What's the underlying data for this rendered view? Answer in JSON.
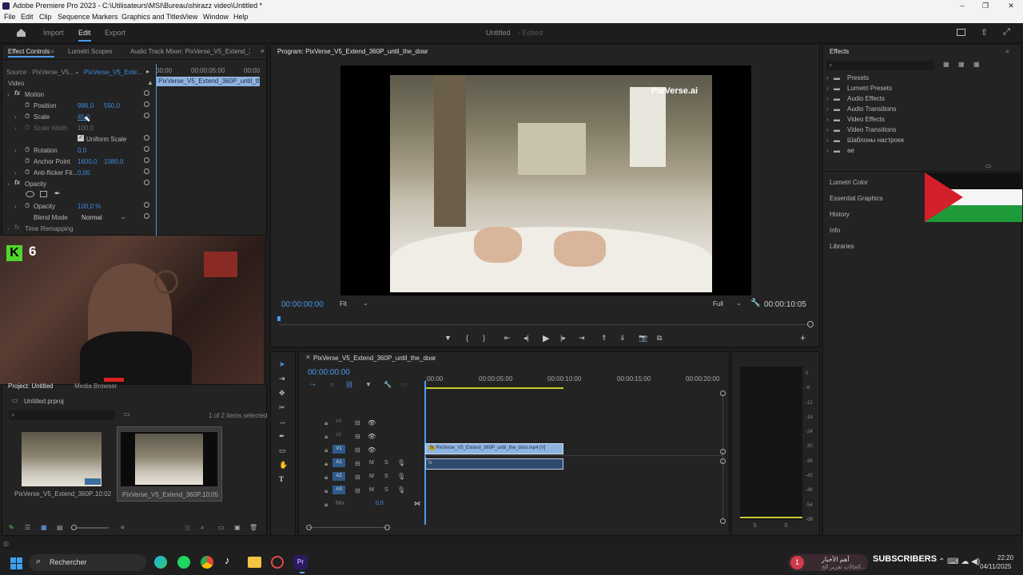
{
  "window": {
    "title": "Adobe Premiere Pro 2023 - C:\\Utilisateurs\\MSI\\Bureau\\shirazz video\\Untitled *"
  },
  "menu": [
    "File",
    "Edit",
    "Clip",
    "Sequence",
    "Markers",
    "Graphics and Titles",
    "View",
    "Window",
    "Help"
  ],
  "workspace": {
    "tabs": [
      "Import",
      "Edit",
      "Export"
    ],
    "active": "Edit",
    "doc_title": "Untitled",
    "doc_status": "- Edited"
  },
  "effect_controls": {
    "tabs": [
      "Effect Controls",
      "Lumetri Scopes",
      "Audio Track Mixer: PixVerse_V5_Extend_36C"
    ],
    "source": "Source · PixVerse_V5...",
    "sequence": "PixVerse_V5_Exte...",
    "ruler": [
      "00:00",
      "00:00:05:00",
      "00:00"
    ],
    "clip_name": "PixVerse_V5_Extend_360P_until_the_",
    "section": "Video",
    "motion": "Motion",
    "position_label": "Position",
    "position_x": "986,0",
    "position_y": "550,0",
    "scale_label": "Scale",
    "scale_value": "45,0",
    "scale_width_label": "Scale Width",
    "scale_width_value": "100,0",
    "uniform_scale": "Uniform Scale",
    "rotation_label": "Rotation",
    "rotation_value": "0,0",
    "anchor_label": "Anchor Point",
    "anchor_x": "1600,0",
    "anchor_y": "1080,0",
    "flicker_label": "Anti-flicker Fil...",
    "flicker_value": "0,00",
    "opacity_section": "Opacity",
    "opacity_label": "Opacity",
    "opacity_value": "100,0 %",
    "blend_label": "Blend Mode",
    "blend_value": "Normal",
    "time_remap": "Time Remapping"
  },
  "webcam": {
    "badge_number": "6"
  },
  "project": {
    "tabs": [
      "Project: Untitled",
      "Media Browser"
    ],
    "file": "Untitled.prproj",
    "count": "1 of 2 items selected",
    "items": [
      {
        "name": "PixVerse_V5_Extend_360P...",
        "duration": "10:02"
      },
      {
        "name": "PixVerse_V5_Extend_360P...",
        "duration": "10:05"
      }
    ]
  },
  "program": {
    "title": "Program: PixVerse_V5_Extend_360P_until_the_door",
    "watermark": "PixVerse.ai",
    "timecode": "00:00:00:00",
    "fit": "Fit",
    "quality": "Full",
    "duration": "00:00:10:05"
  },
  "timeline": {
    "sequence": "PixVerse_V5_Extend_360P_until_the_door",
    "timecode": "00:00:00:00",
    "ruler": [
      ":00:00",
      "00:00:05:00",
      "00:00:10:00",
      "00:00:15:00",
      "00:00:20:00"
    ],
    "tracks": [
      "V3",
      "V2",
      "V1",
      "A1",
      "A2",
      "A3"
    ],
    "mix_label": "Mix",
    "mix_value": "0,0",
    "video_clip": "PixVerse_V5_Extend_360P_until_the_door.mp4 [V]",
    "meter_db": [
      "0",
      "-6",
      "-12",
      "-18",
      "-24",
      "-30",
      "-36",
      "-42",
      "-48",
      "-54",
      "-dB"
    ],
    "meter_solo": [
      "S",
      "S"
    ]
  },
  "effects": {
    "title": "Effects",
    "tree": [
      "Presets",
      "Lumetri Presets",
      "Audio Effects",
      "Audio Transitions",
      "Video Effects",
      "Video Transitions",
      "Шаблоны настроек",
      "ae"
    ],
    "panels": [
      "Lumetri Color",
      "Essential Graphics",
      "History",
      "Info",
      "Libraries"
    ]
  },
  "taskbar": {
    "search": "Rechercher",
    "notify_count": "1",
    "news": "أهم الأخبار",
    "news2": "الحالات تقرير الخ...",
    "subscribers": "SUBSCRIBERS",
    "time": "22:20",
    "date": "04/11/2025"
  },
  "colors": {
    "accent": "#4a9af0",
    "clip_video": "#8fb4e0",
    "premiere": "#2b1b5e"
  }
}
